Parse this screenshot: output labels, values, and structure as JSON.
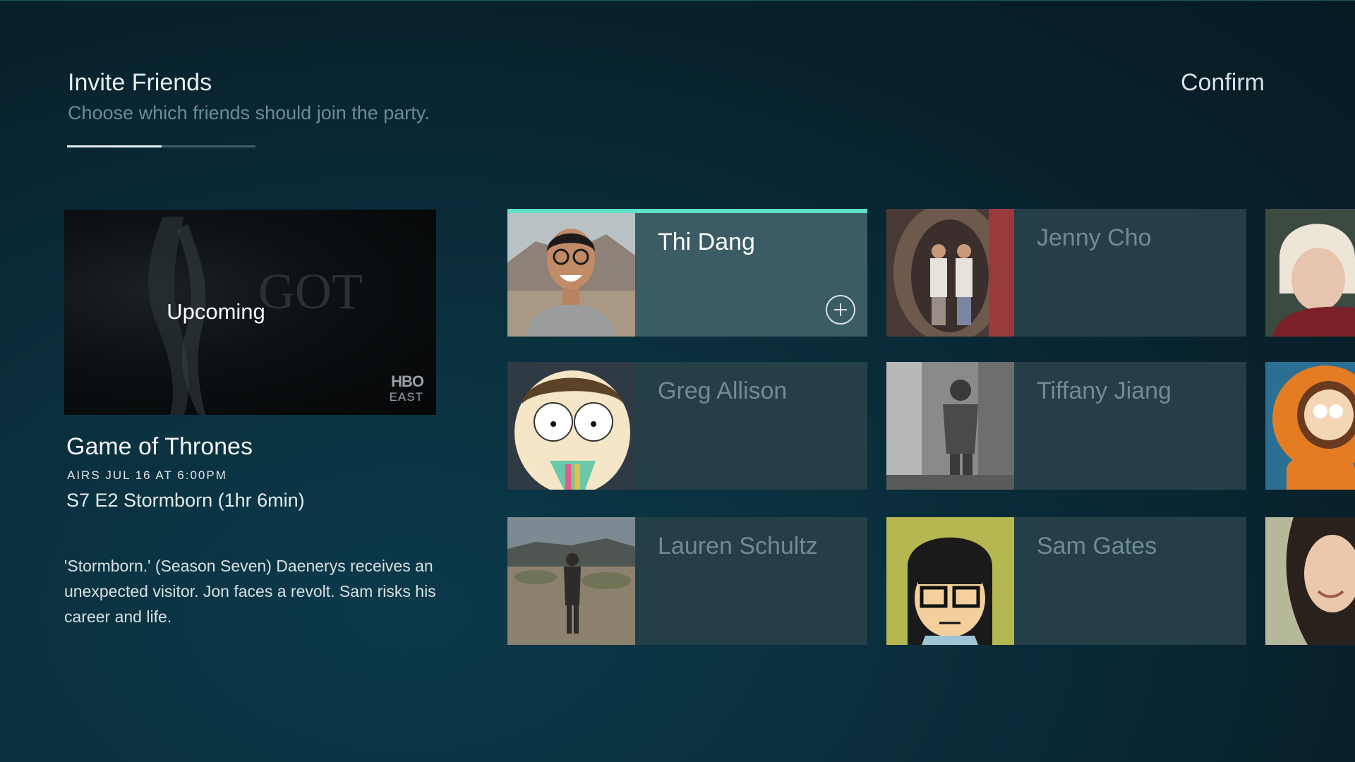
{
  "header": {
    "title": "Invite Friends",
    "subtitle": "Choose which friends should join the party.",
    "confirm_label": "Confirm",
    "progress": 0.5
  },
  "show": {
    "status": "Upcoming",
    "network_line1": "HBO",
    "network_line2": "EAST",
    "title": "Game of Thrones",
    "airs": "AIRS JUL 16 AT 6:00PM",
    "episode": "S7 E2 Stormborn (1hr 6min)",
    "description": "'Stormborn.' (Season Seven) Daenerys receives an unexpected visitor. Jon faces a revolt. Sam risks his career and life."
  },
  "friends": [
    {
      "name": "Thi Dang",
      "selected": true
    },
    {
      "name": "Jenny Cho",
      "selected": false
    },
    {
      "name": "Greg Allison",
      "selected": false
    },
    {
      "name": "Tiffany Jiang",
      "selected": false
    },
    {
      "name": "Lauren Schultz",
      "selected": false
    },
    {
      "name": "Sam Gates",
      "selected": false
    }
  ],
  "colors": {
    "accent": "#5fe0c8",
    "card": "#243f48",
    "card_selected": "#3b5b65"
  }
}
